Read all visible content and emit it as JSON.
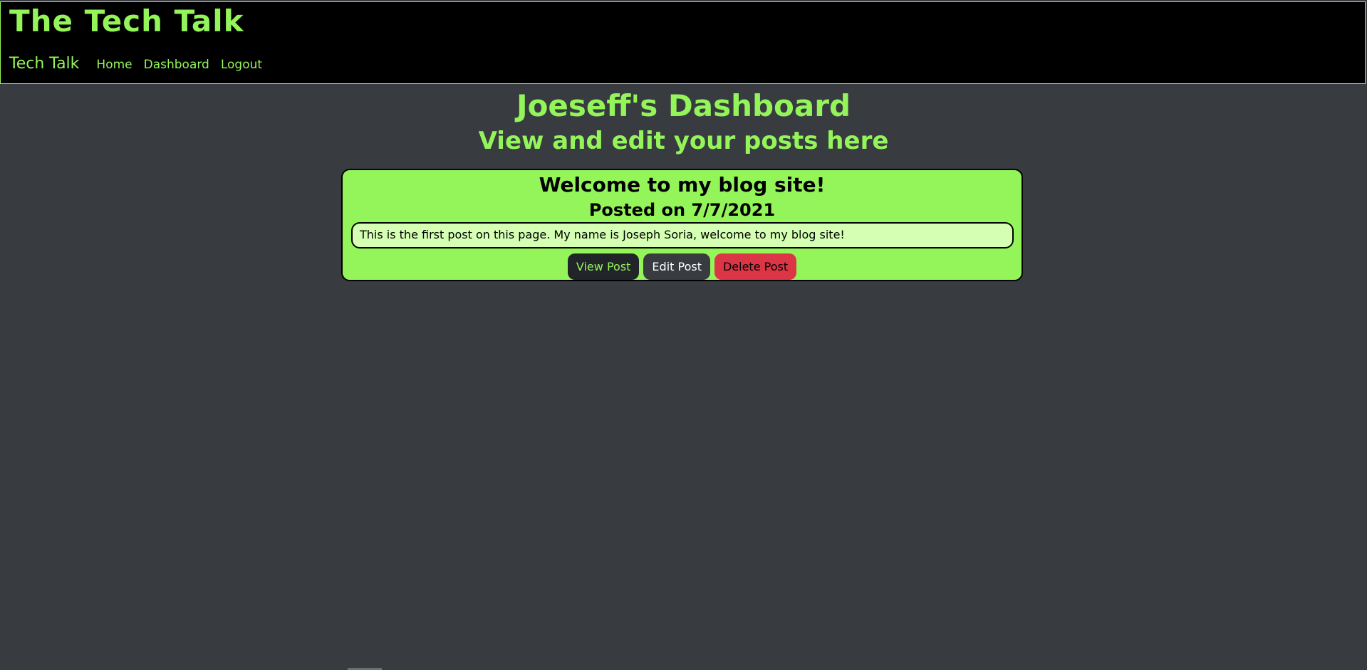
{
  "header": {
    "site_title": "The Tech Talk",
    "brand": "Tech Talk",
    "nav": {
      "home": "Home",
      "dashboard": "Dashboard",
      "logout": "Logout"
    }
  },
  "main": {
    "heading": "Joeseff's Dashboard",
    "subheading": "View and edit your posts here"
  },
  "posts": [
    {
      "title": "Welcome to my blog site!",
      "date_label": "Posted on 7/7/2021",
      "body": "This is the first post on this page. My name is Joseph Soria, welcome to my blog site!",
      "actions": {
        "view": "View Post",
        "edit": "Edit Post",
        "delete": "Delete Post"
      }
    }
  ],
  "colors": {
    "accent": "#94f55a",
    "background": "#383c40",
    "header_background": "#000000",
    "post_body_background": "#d5ffb3",
    "view_button": "#212529",
    "edit_button": "#383c40",
    "delete_button": "#dc3545"
  }
}
